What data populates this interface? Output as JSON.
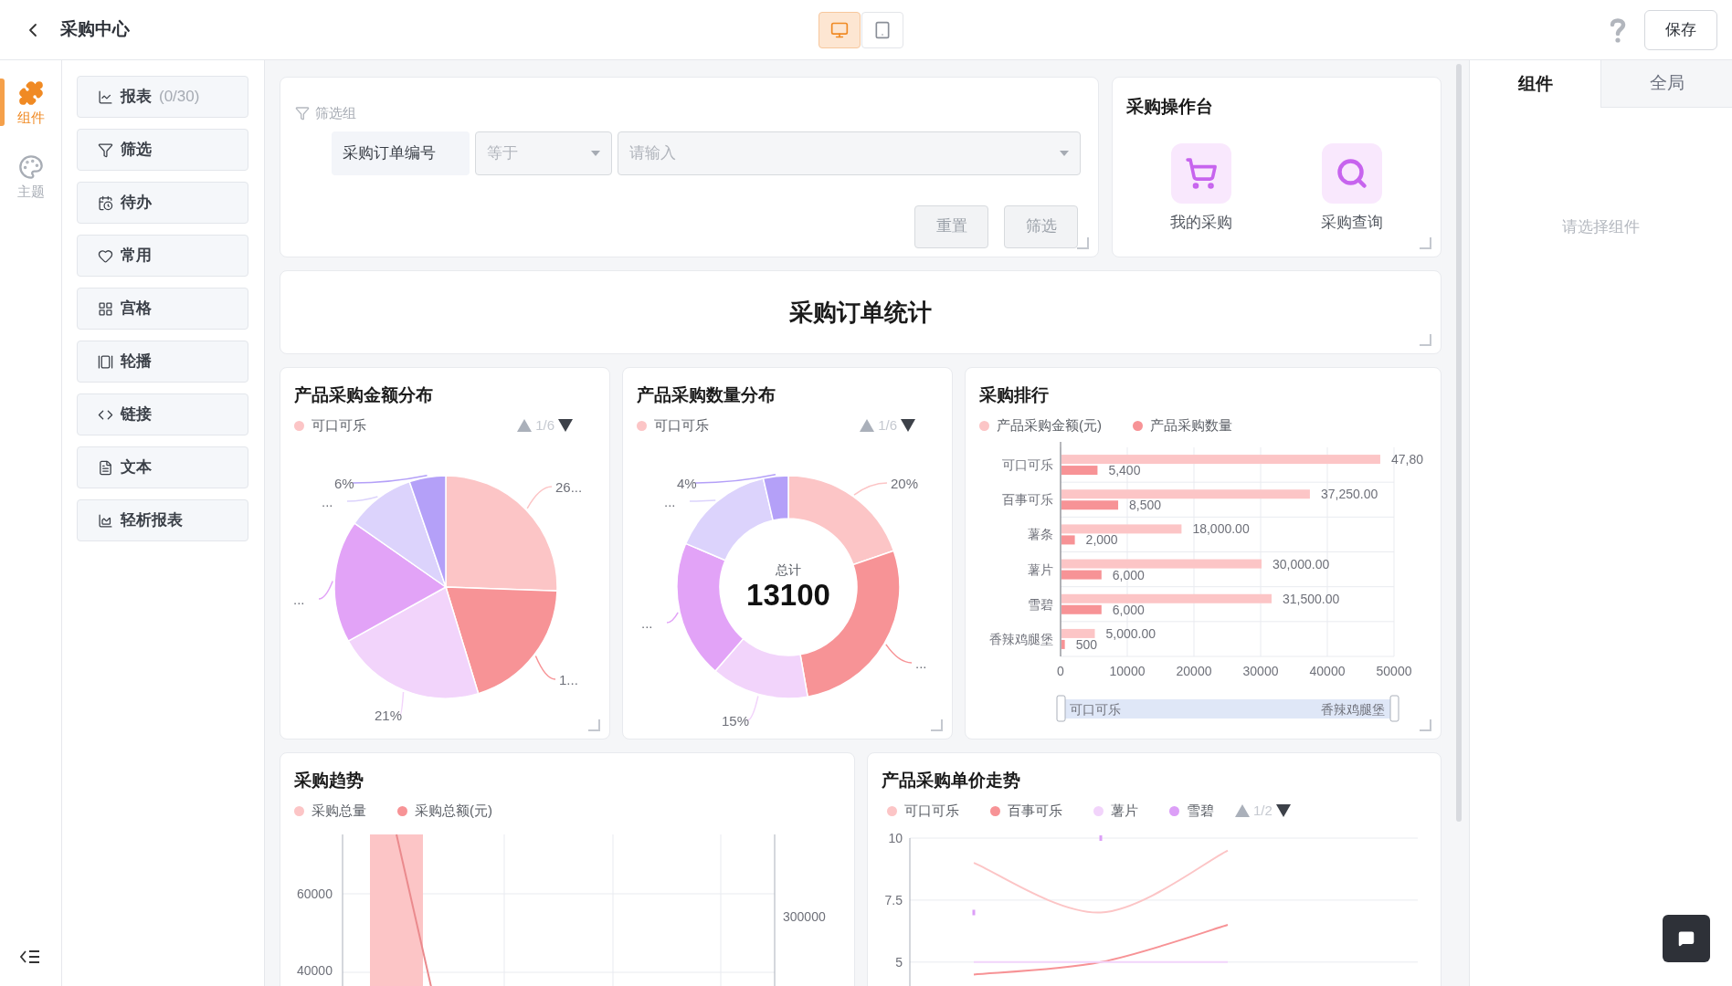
{
  "header": {
    "title": "采购中心",
    "views": [
      {
        "kind": "desktop",
        "selected": true
      },
      {
        "kind": "tablet",
        "selected": false
      }
    ],
    "save": "保存"
  },
  "rail": [
    {
      "kind": "components",
      "label": "组件",
      "selected": true
    },
    {
      "kind": "theme",
      "label": "主题",
      "selected": false
    }
  ],
  "palette": [
    {
      "kind": "report",
      "label": "报表",
      "count": "(0/30)"
    },
    {
      "kind": "filter",
      "label": "筛选"
    },
    {
      "kind": "todo",
      "label": "待办"
    },
    {
      "kind": "favorite",
      "label": "常用"
    },
    {
      "kind": "grid",
      "label": "宫格"
    },
    {
      "kind": "carousel",
      "label": "轮播"
    },
    {
      "kind": "link",
      "label": "链接"
    },
    {
      "kind": "text",
      "label": "文本"
    },
    {
      "kind": "lite_report",
      "label": "轻析报表"
    }
  ],
  "filter_card": {
    "title": "筛选组",
    "field_label": "采购订单编号",
    "operator": {
      "placeholder": "等于"
    },
    "value": {
      "placeholder": "请输入"
    },
    "buttons": [
      "重置",
      "筛选"
    ]
  },
  "ops_card": {
    "title": "采购操作台",
    "actions": [
      {
        "kind": "cart",
        "label": "我的采购"
      },
      {
        "kind": "search",
        "label": "采购查询"
      }
    ]
  },
  "heading_card": {
    "title": "采购订单统计"
  },
  "amount_pie": {
    "title": "产品采购金额分布",
    "legend": [
      {
        "label": "可口可乐",
        "color": "#fcc5c6"
      }
    ],
    "pager": {
      "text": "1/6",
      "prev_disabled": true,
      "next_disabled": false
    },
    "slice_labels": [
      "26...",
      "1...",
      "21%",
      "...",
      "...",
      "6%"
    ]
  },
  "qty_donut": {
    "title": "产品采购数量分布",
    "legend": [
      {
        "label": "可口可乐",
        "color": "#fcc5c6"
      }
    ],
    "pager": {
      "text": "1/6",
      "prev_disabled": true,
      "next_disabled": false
    },
    "slice_labels": [
      "20%",
      "...",
      "15%",
      "...",
      "...",
      "4%"
    ],
    "center_label": "总计",
    "center_value": "13100"
  },
  "ranking": {
    "title": "采购排行",
    "chart_data": {
      "type": "bar",
      "orientation": "horizontal",
      "categories": [
        "可口可乐",
        "百事可乐",
        "薯条",
        "薯片",
        "雪碧",
        "香辣鸡腿堡"
      ],
      "series": [
        {
          "name": "产品采购金额(元)",
          "color": "#fcc5c6",
          "values": [
            47800,
            37250,
            18000,
            30000,
            31500,
            5000
          ]
        },
        {
          "name": "产品采购数量",
          "color": "#f79396",
          "values": [
            5400,
            8500,
            2000,
            6000,
            6000,
            500
          ]
        }
      ],
      "xlim": [
        0,
        50000
      ],
      "grid": true,
      "xticks": [
        0,
        10000,
        20000,
        30000,
        40000,
        50000
      ],
      "value_labels": [
        [
          "47,80",
          "37,250.00",
          "18,000.00",
          "30,000.00",
          "31,500.00",
          "5,000.00"
        ],
        [
          "5,400",
          "8,500",
          "2,000",
          "6,000",
          "6,000",
          "500"
        ]
      ]
    },
    "zoom": {
      "start": "可口可乐",
      "end": "香辣鸡腿堡"
    }
  },
  "trend": {
    "title": "采购趋势",
    "legend": [
      {
        "label": "采购总量",
        "color": "#fcc5c6"
      },
      {
        "label": "采购总额(元)",
        "color": "#f79396"
      }
    ],
    "left_ticks": [
      "60000",
      "40000"
    ],
    "right_ticks": [
      "300000"
    ]
  },
  "unit_price": {
    "title": "产品采购单价走势",
    "pager": {
      "text": "1/2",
      "prev_disabled": true,
      "next_disabled": false
    },
    "chart_data": {
      "type": "line",
      "series": [
        {
          "name": "可口可乐",
          "type": "line",
          "color": "#fcc5c6",
          "values": [
            9,
            7,
            9.5,
            null
          ]
        },
        {
          "name": "百事可乐",
          "type": "line",
          "color": "#f79396",
          "values": [
            4.5,
            5,
            6.5,
            null
          ]
        },
        {
          "name": "薯片",
          "type": "line",
          "color": "#f2d4fb",
          "values": [
            5,
            5,
            5,
            null
          ]
        },
        {
          "name": "雪碧",
          "type": "scatter",
          "color": "#dc9ff7",
          "values": [
            7,
            10,
            null,
            null
          ]
        }
      ],
      "ylim": [
        4,
        10
      ],
      "yticks": [
        5,
        7.5,
        10
      ]
    }
  },
  "right_panel": {
    "tabs": [
      {
        "label": "组件",
        "selected": true
      },
      {
        "label": "全局",
        "selected": false
      }
    ],
    "empty_text": "请选择组件"
  }
}
